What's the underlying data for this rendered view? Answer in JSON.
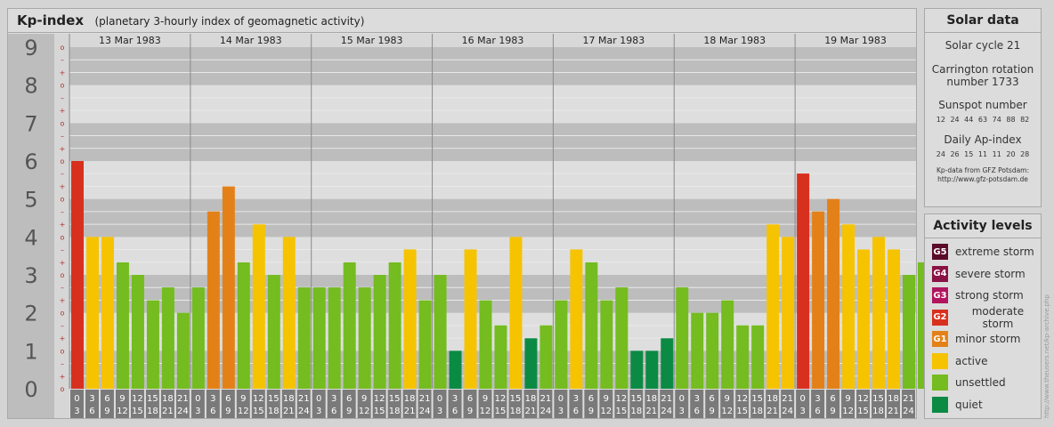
{
  "header": {
    "title": "Kp-index",
    "subtitle": "(planetary 3-hourly index of geomagnetic activity)"
  },
  "chart_data": {
    "type": "bar",
    "title": "Kp-index",
    "subtitle": "(planetary 3-hourly index of geomagnetic activity)",
    "days": [
      "13 Mar 1983",
      "14 Mar 1983",
      "15 Mar 1983",
      "16 Mar 1983",
      "17 Mar 1983",
      "18 Mar 1983",
      "19 Mar 1983"
    ],
    "hour_ticks_top": [
      "0",
      "3",
      "6",
      "9",
      "12",
      "15",
      "18",
      "21"
    ],
    "hour_ticks_bottom": [
      "3",
      "6",
      "9",
      "12",
      "15",
      "18",
      "21",
      "24"
    ],
    "y_ticks": [
      "0",
      "1",
      "2",
      "3",
      "4",
      "5",
      "6",
      "7",
      "8",
      "9"
    ],
    "y_subticks": [
      "o",
      "+",
      "–",
      "o"
    ],
    "ylim": [
      0,
      9
    ],
    "values": [
      6.0,
      4.0,
      4.0,
      3.33,
      3.0,
      2.33,
      2.67,
      2.0,
      2.67,
      4.67,
      5.33,
      3.33,
      4.33,
      3.0,
      4.0,
      2.67,
      2.67,
      2.67,
      3.33,
      2.67,
      3.0,
      3.33,
      3.67,
      2.33,
      3.0,
      1.0,
      3.67,
      2.33,
      1.67,
      4.0,
      1.33,
      1.67,
      2.33,
      3.67,
      3.33,
      2.33,
      2.67,
      1.0,
      1.0,
      1.33,
      2.67,
      2.0,
      2.0,
      2.33,
      1.67,
      1.67,
      4.33,
      4.0,
      5.67,
      4.67,
      5.0,
      4.33,
      3.67,
      4.0,
      3.67,
      3.0,
      3.33
    ],
    "bar_colors": {
      "quiet": "#0b8a43",
      "unsettled": "#74bc1f",
      "active": "#f6c300",
      "G1": "#e38118",
      "G2": "#d8301e",
      "G3": "#b0155e",
      "G4": "#8a1245",
      "G5": "#5a0b2a"
    },
    "grid": true
  },
  "solar": {
    "title": "Solar data",
    "cycle": "Solar cycle 21",
    "carrington_1": "Carrington rotation",
    "carrington_2": "number 1733",
    "sunspot_title": "Sunspot number",
    "sunspot_values": "12 24 44 63 74 88 82",
    "ap_title": "Daily Ap-index",
    "ap_values": "24 26 15 11 11 20 28",
    "source_1": "Kp-data from GFZ Potsdam:",
    "source_2": "http://www.gfz-potsdam.de"
  },
  "activity": {
    "title": "Activity levels",
    "items": [
      {
        "code": "G5",
        "label": "extreme storm",
        "color": "#5a0b2a"
      },
      {
        "code": "G4",
        "label": "severe storm",
        "color": "#8a1245"
      },
      {
        "code": "G3",
        "label": "strong storm",
        "color": "#b0155e"
      },
      {
        "code": "G2",
        "label": "moderate storm",
        "color": "#d8301e"
      },
      {
        "code": "G1",
        "label": "minor storm",
        "color": "#e38118"
      },
      {
        "code": "",
        "label": "active",
        "color": "#f6c300"
      },
      {
        "code": "",
        "label": "unsettled",
        "color": "#74bc1f"
      },
      {
        "code": "",
        "label": "quiet",
        "color": "#0b8a43"
      }
    ]
  },
  "credit": "http://www.theusers.net/kp-archive.php"
}
